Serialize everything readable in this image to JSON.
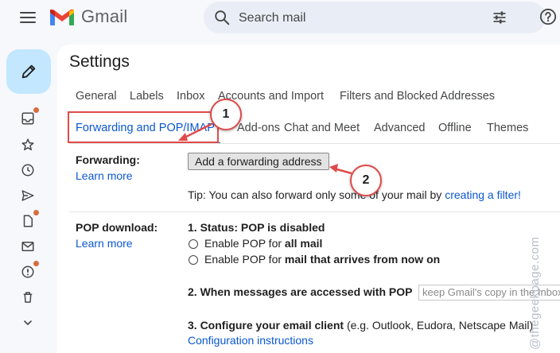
{
  "header": {
    "app_name": "Gmail",
    "search_placeholder": "Search mail"
  },
  "settings": {
    "title": "Settings",
    "tabs_row1": [
      "General",
      "Labels",
      "Inbox",
      "Accounts and Import",
      "Filters and Blocked Addresses"
    ],
    "tabs_row2": [
      "Forwarding and POP/IMAP",
      "Add-ons",
      "Chat and Meet",
      "Advanced",
      "Offline",
      "Themes"
    ],
    "active_tab": "Forwarding and POP/IMAP"
  },
  "forwarding": {
    "label": "Forwarding:",
    "learn_more": "Learn more",
    "button": "Add a forwarding address",
    "tip_prefix": "Tip: You can also forward only some of your mail by",
    "tip_link": "creating a filter!"
  },
  "pop": {
    "label": "POP download:",
    "learn_more": "Learn more",
    "status": "1. Status: POP is disabled",
    "option1_prefix": "Enable POP for",
    "option1_bold": "all mail",
    "option2_prefix": "Enable POP for",
    "option2_bold": "mail that arrives from now on",
    "step2": "2. When messages are accessed with POP",
    "step2_select": "keep Gmail's copy in the Inbox",
    "step3_bold": "3. Configure your email client",
    "step3_rest": "(e.g. Outlook, Eudora, Netscape Mail)",
    "config_link": "Configuration instructions"
  },
  "annotations": {
    "callout1": "1",
    "callout2": "2",
    "accent": "#e04a4a"
  },
  "watermark": "@thegeekpage.com",
  "colors": {
    "link": "#0b57d0",
    "compose_bg": "#c2e7ff",
    "notification_dot": "#d56e3e"
  },
  "icons": {
    "menu": "menu-icon",
    "search": "search-icon",
    "tune": "tune-icon",
    "help": "help-icon",
    "compose": "pencil-icon",
    "rail": [
      "inbox-icon",
      "star-icon",
      "clock-icon",
      "send-icon",
      "draft-icon",
      "mail-icon",
      "important-icon",
      "trash-icon",
      "chevron-down-icon"
    ]
  }
}
